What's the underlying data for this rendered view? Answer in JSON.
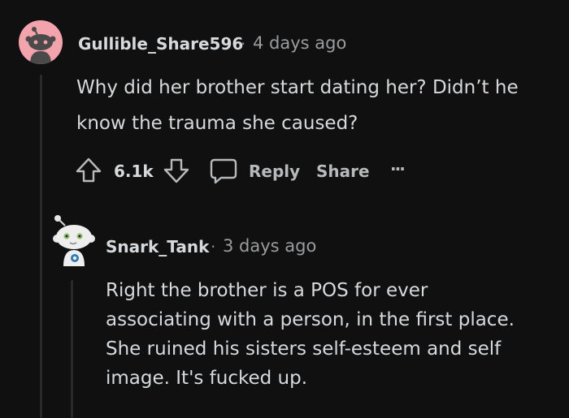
{
  "comments": [
    {
      "username": "Gullible_Share596",
      "separator": "·",
      "time": "4 days ago",
      "lines": [
        "Why did her brother start dating her? Didn’t he",
        "know the trauma she caused?"
      ],
      "score": "6.1k",
      "actions": {
        "reply": "Reply",
        "share": "Share",
        "more": "···"
      }
    },
    {
      "username": "Snark_Tank",
      "separator": "·",
      "time": "3 days ago",
      "lines": [
        "Right the brother is a POS for ever",
        "associating with a person, in the first place.",
        "She ruined his sisters self-esteem and self",
        "image. It's fucked up."
      ]
    }
  ],
  "colors": {
    "background": "#101010",
    "avatar1_bg": "#f1a0a8",
    "text": "#d7dadc",
    "muted": "#9a9c9e"
  },
  "icons": [
    "upvote-icon",
    "downvote-icon",
    "comment-icon",
    "more-icon",
    "snoo-avatar-icon"
  ]
}
